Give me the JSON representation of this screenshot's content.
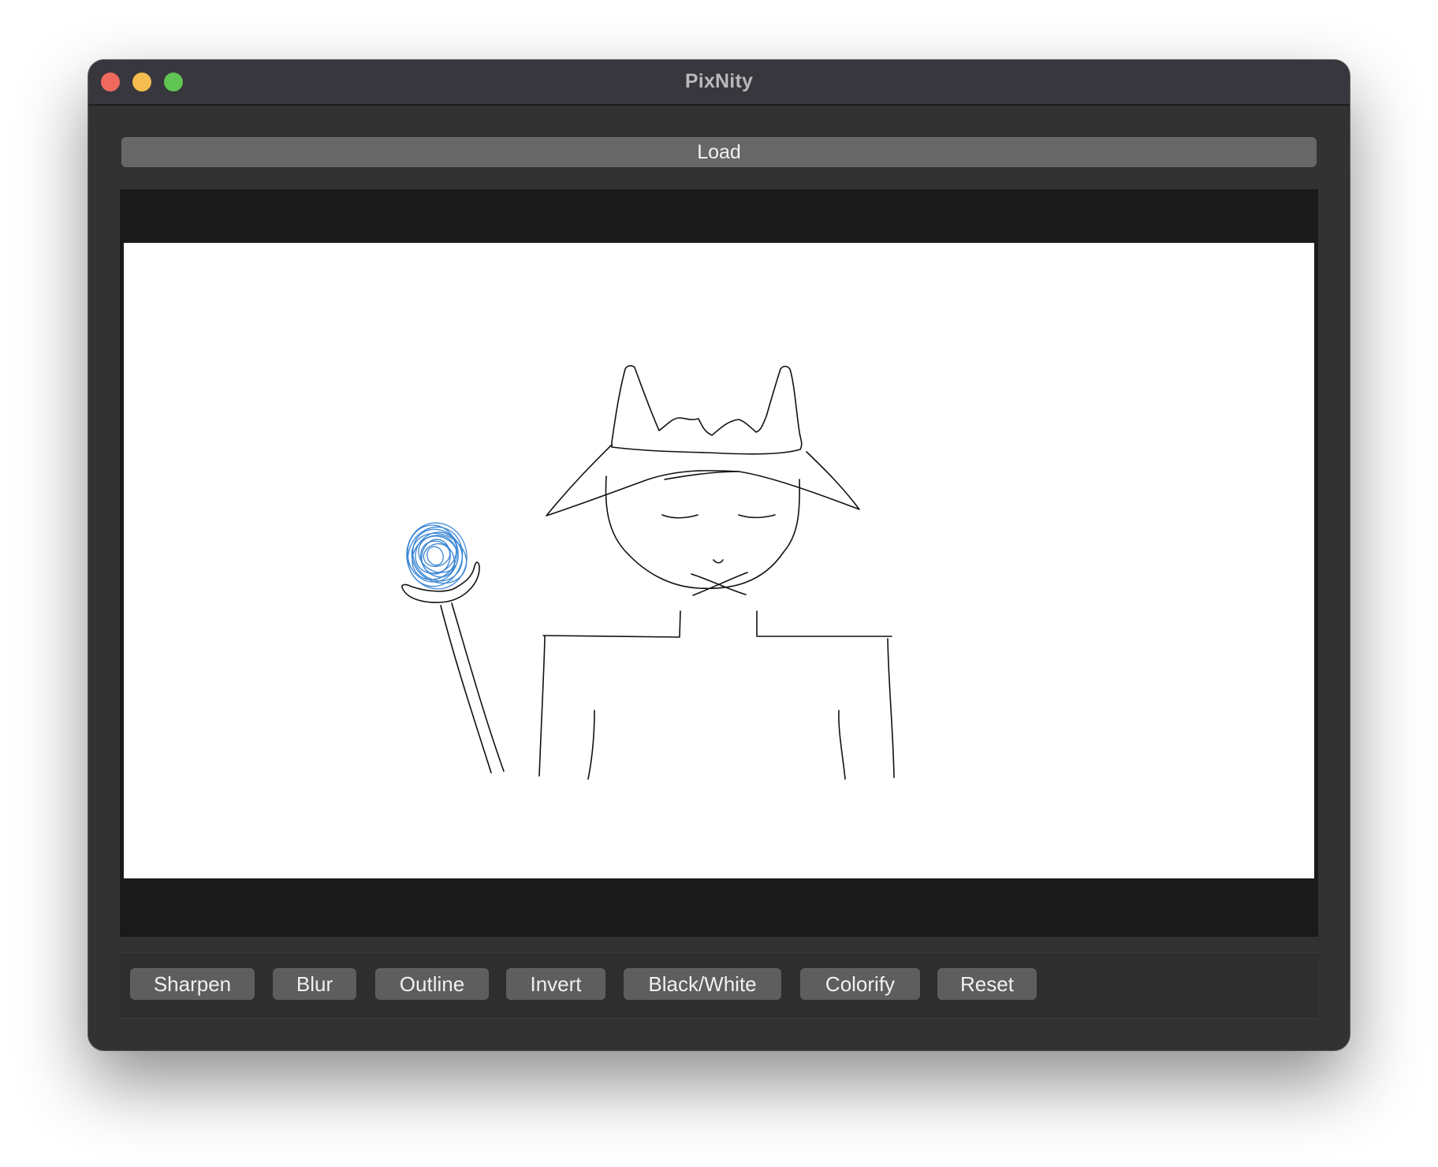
{
  "window": {
    "title": "PixNity"
  },
  "toolbar_top": {
    "load_label": "Load"
  },
  "filters": {
    "sharpen": "Sharpen",
    "blur": "Blur",
    "outline": "Outline",
    "invert": "Invert",
    "black_white": "Black/White",
    "colorify": "Colorify",
    "reset": "Reset"
  },
  "colors": {
    "window_bg": "#323232",
    "titlebar_bg": "#38373d",
    "button_bg": "#5e5e5e",
    "viewer_bg": "#1a1a1a",
    "sketch_stroke": "#111111",
    "orb_stroke": "#3a86d4"
  },
  "image": {
    "description_icon": "wizard-sketch"
  }
}
